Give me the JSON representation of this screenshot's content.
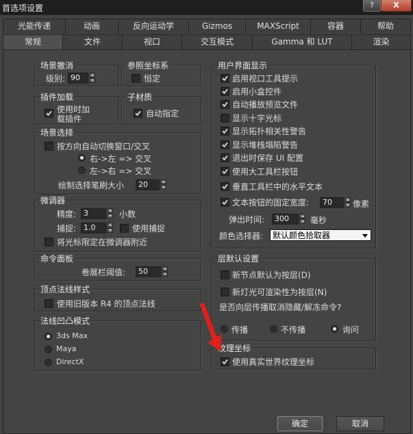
{
  "window": {
    "title": "首选项设置",
    "help_btn": "?",
    "close_btn": "X"
  },
  "tabs_row1": [
    "光能传递",
    "动画",
    "反向运动学",
    "Gizmos",
    "MAXScript",
    "容器",
    "帮助"
  ],
  "tabs_row2": [
    "常规",
    "文件",
    "视口",
    "交互模式",
    "Gamma 和 LUT",
    "渲染"
  ],
  "active_tab": "常规",
  "scene_undo": {
    "legend": "场景撤消",
    "level_label": "级别:",
    "level_value": "90"
  },
  "ref_coord": {
    "legend": "参照坐标系",
    "constant_label": "恒定",
    "constant_checked": false
  },
  "plugin_load": {
    "legend": "插件加载",
    "load_on_demand_label_1": "使用时加",
    "load_on_demand_label_2": "载插件",
    "checked": true
  },
  "sub_material": {
    "legend": "子材质",
    "auto_assign_label": "自动指定",
    "checked": true
  },
  "scene_select": {
    "legend": "场景选择",
    "auto_switch_label": "按方向自动切换窗口/交叉",
    "auto_switch_checked": false,
    "radio_rl": "右->左 => 交叉",
    "radio_lr": "左->右 => 交叉",
    "brush_label": "绘制选择笔刷大小",
    "brush_value": "20"
  },
  "spinners": {
    "legend": "微调器",
    "precision_label": "精度:",
    "precision_value": "3",
    "decimals_label": "小数",
    "snap_label": "捕捉:",
    "snap_value": "1.0",
    "use_snap_label": "使用捕捉",
    "use_snap_checked": false,
    "cursor_limit_label": "将光标限定在微调器附近",
    "cursor_limit_checked": false
  },
  "command_panel": {
    "legend": "命令面板",
    "rollout_label": "卷展栏阈值:",
    "rollout_value": "50"
  },
  "vertex_normal": {
    "legend": "顶点法线样式",
    "legacy_label": "使用旧版本 R4 的顶点法线",
    "legacy_checked": false
  },
  "normal_bump": {
    "legend": "法线凹凸模式",
    "options": [
      "3ds Max",
      "Maya",
      "DirectX"
    ],
    "selected": "3ds Max"
  },
  "ui_display": {
    "legend": "用户界面显示",
    "items": [
      {
        "label": "启用视口工具提示",
        "checked": true
      },
      {
        "label": "启用小盒控件",
        "checked": true
      },
      {
        "label": "自动播放预览文件",
        "checked": true
      },
      {
        "label": "显示十字光标",
        "checked": false
      },
      {
        "label": "显示拓扑相关性警告",
        "checked": true
      },
      {
        "label": "显示堆栈塌陷警告",
        "checked": true
      },
      {
        "label": "退出时保存 UI 配置",
        "checked": true
      },
      {
        "label": "使用大工具栏按钮",
        "checked": true
      },
      {
        "label": "垂直工具栏中的水平文本",
        "checked": true
      },
      {
        "label": "文本按钮的固定宽度:",
        "checked": true
      }
    ],
    "fixed_width_value": "70",
    "fixed_width_unit": "像素",
    "flyout_label": "弹出时间:",
    "flyout_value": "300",
    "flyout_unit": "毫秒",
    "color_picker_label": "颜色选择器:",
    "color_picker_value": "默认颜色拾取器"
  },
  "layer_defaults": {
    "legend": "层默认设置",
    "new_node_label": "新节点默认为按层(D)",
    "new_node_checked": false,
    "new_light_label": "新灯光可渲染性为按层(N)",
    "new_light_checked": false,
    "propagate_question": "是否向层传播取消隐藏/解冻命令?",
    "radios": [
      "传播",
      "不传播",
      "询问"
    ],
    "radio_selected": "询问"
  },
  "texture_coords": {
    "legend": "纹理坐标",
    "real_world_label": "使用真实世界纹理坐标",
    "checked": true
  },
  "buttons": {
    "ok": "确定",
    "cancel": "取消"
  },
  "colors": {
    "background": "#444444",
    "titlebar": "#1e1e1e",
    "arrow": "#e0201a",
    "close_button": "#c0503a"
  },
  "icons": {
    "annotation": "red-arrow-icon",
    "checkmark": "checkmark-icon"
  }
}
